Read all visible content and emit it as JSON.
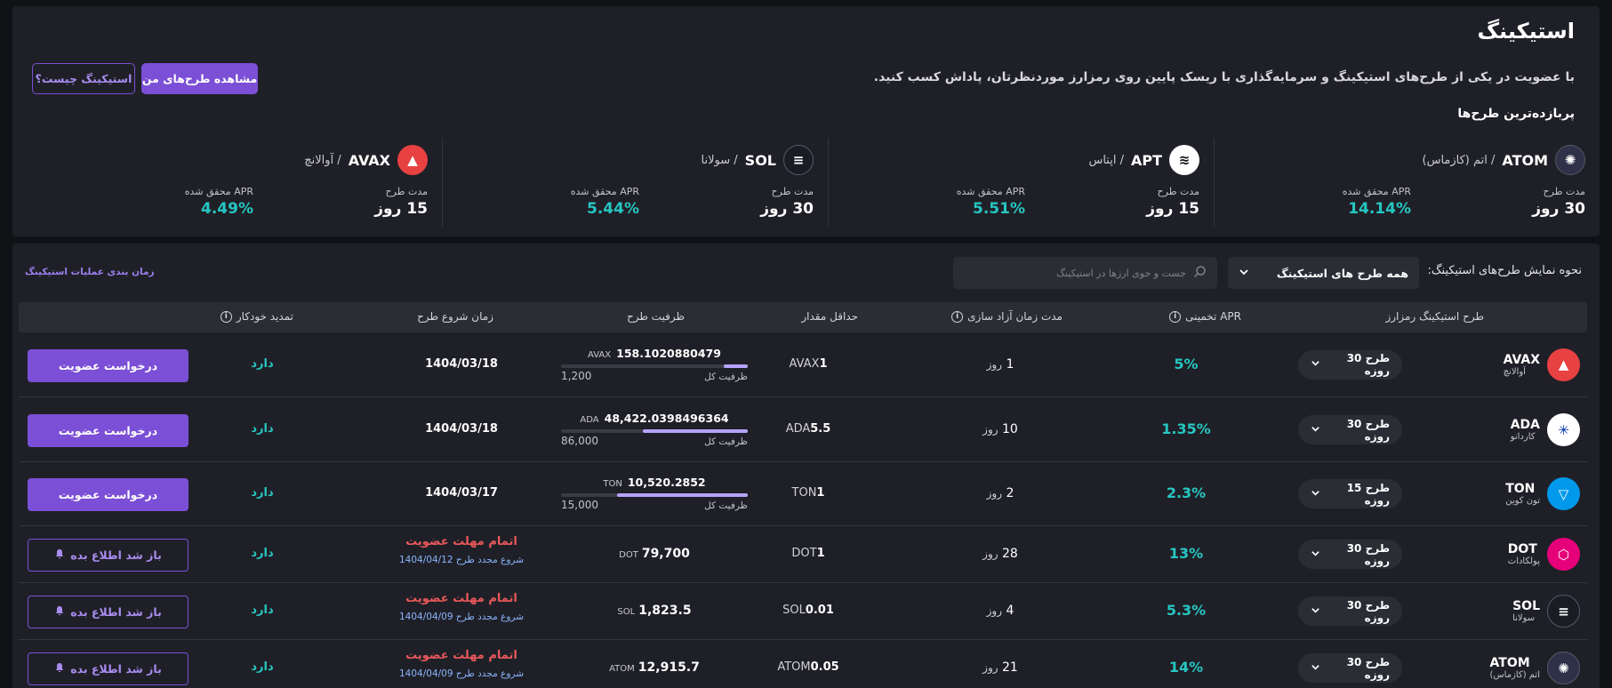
{
  "header": {
    "title": "استیکینگ",
    "subtitle": "با عضویت در یکی از طرح‌های استیکینگ و سرمایه‌گذاری با ریسک پایین روی رمزارز موردنظرتان، پاداش کسب کنید.",
    "my_plans_button": "مشاهده طرح‌های من",
    "what_is_button": "استیکینگ چیست؟",
    "section_title": "پربازده‌ترین طرح‌ها"
  },
  "top_plans": [
    {
      "symbol": "ATOM",
      "name": "/ اتم (کازماس)",
      "duration_label": "مدت طرح",
      "duration": "30 روز",
      "apr_label": "APR محقق شده",
      "apr": "14.14%",
      "icon_color": "#2e3148",
      "icon_glyph": "✺"
    },
    {
      "symbol": "APT",
      "name": "/ اپتاس",
      "duration_label": "مدت طرح",
      "duration": "15 روز",
      "apr_label": "APR محقق شده",
      "apr": "5.51%",
      "icon_color": "#ffffff",
      "icon_glyph": "≋"
    },
    {
      "symbol": "SOL",
      "name": "/ سولانا",
      "duration_label": "مدت طرح",
      "duration": "30 روز",
      "apr_label": "APR محقق شده",
      "apr": "5.44%",
      "icon_color": "#1a1c24",
      "icon_glyph": "≡"
    },
    {
      "symbol": "AVAX",
      "name": "/ آوالانچ",
      "duration_label": "مدت طرح",
      "duration": "15 روز",
      "apr_label": "APR محقق شده",
      "apr": "4.49%",
      "icon_color": "#e84142",
      "icon_glyph": "▲"
    }
  ],
  "controls": {
    "display_label": "نحوه نمایش طرح‌های استیکینگ:",
    "display_select": "همه طرح های استیکینگ",
    "search_placeholder": "جست و جوی ارزها در استیکینگ",
    "schedule_link": "زمان بندی عملیات استیکینگ"
  },
  "table": {
    "headers": {
      "coin": "طرح استیکینگ رمزارز",
      "apr": "APR تخمینی",
      "release": "مدت زمان آزاد سازی",
      "min_amount": "حداقل مقدار",
      "capacity": "ظرفیت طرح",
      "start": "زمان شروع طرح",
      "auto_renew": "تمدید خودکار"
    },
    "capacity_total_label": "ظرفیت کل",
    "rows": [
      {
        "symbol": "AVAX",
        "name": "آوالانچ",
        "icon_color": "#e84142",
        "icon_glyph": "▲",
        "plan": "طرح 30 روزه",
        "apr": "5%",
        "release_num": "1",
        "release_unit": "روز",
        "min_num": "1",
        "min_unit": "AVAX",
        "cap_value": "158.1020880479",
        "cap_unit": "AVAX",
        "cap_total": "1,200",
        "cap_ratio": 0.13,
        "start": "1404/03/18",
        "auto": "دارد",
        "action": "درخواست عضویت"
      },
      {
        "symbol": "ADA",
        "name": "کاردانو",
        "icon_color": "#ffffff",
        "icon_glyph": "✳",
        "plan": "طرح 30 روزه",
        "apr": "1.35%",
        "release_num": "10",
        "release_unit": "روز",
        "min_num": "5.5",
        "min_unit": "ADA",
        "cap_value": "48,422.0398496364",
        "cap_unit": "ADA",
        "cap_total": "86,000",
        "cap_ratio": 0.56,
        "start": "1404/03/18",
        "auto": "دارد",
        "action": "درخواست عضویت"
      },
      {
        "symbol": "TON",
        "name": "تون کوین",
        "icon_color": "#0098ea",
        "icon_glyph": "▽",
        "plan": "طرح 15 روزه",
        "apr": "2.3%",
        "release_num": "2",
        "release_unit": "روز",
        "min_num": "1",
        "min_unit": "TON",
        "cap_value": "10,520.2852",
        "cap_unit": "TON",
        "cap_total": "15,000",
        "cap_ratio": 0.7,
        "start": "1404/03/17",
        "auto": "دارد",
        "action": "درخواست عضویت"
      },
      {
        "symbol": "DOT",
        "name": "پولکادات",
        "icon_color": "#e6007a",
        "icon_glyph": "⬡",
        "plan": "طرح 30 روزه",
        "apr": "13%",
        "release_num": "28",
        "release_unit": "روز",
        "min_num": "1",
        "min_unit": "DOT",
        "cap_simple": "79,700",
        "cap_unit": "DOT",
        "ended": "اتمام مهلت عضویت",
        "restart": "شروع مجدد طرح 1404/04/12",
        "auto": "دارد",
        "action": "باز شد اطلاع بده"
      },
      {
        "symbol": "SOL",
        "name": "سولانا",
        "icon_color": "#1a1c24",
        "icon_glyph": "≡",
        "plan": "طرح 30 روزه",
        "apr": "5.3%",
        "release_num": "4",
        "release_unit": "روز",
        "min_num": "0.01",
        "min_unit": "SOL",
        "cap_simple": "1,823.5",
        "cap_unit": "SOL",
        "ended": "اتمام مهلت عضویت",
        "restart": "شروع مجدد طرح 1404/04/09",
        "auto": "دارد",
        "action": "باز شد اطلاع بده"
      },
      {
        "symbol": "ATOM",
        "name": "اتم (کازماس)",
        "icon_color": "#2e3148",
        "icon_glyph": "✺",
        "plan": "طرح 30 روزه",
        "apr": "14%",
        "release_num": "21",
        "release_unit": "روز",
        "min_num": "0.05",
        "min_unit": "ATOM",
        "cap_simple": "12,915.7",
        "cap_unit": "ATOM",
        "ended": "اتمام مهلت عضویت",
        "restart": "شروع مجدد طرح 1404/04/09",
        "auto": "دارد",
        "action": "باز شد اطلاع بده"
      }
    ]
  }
}
